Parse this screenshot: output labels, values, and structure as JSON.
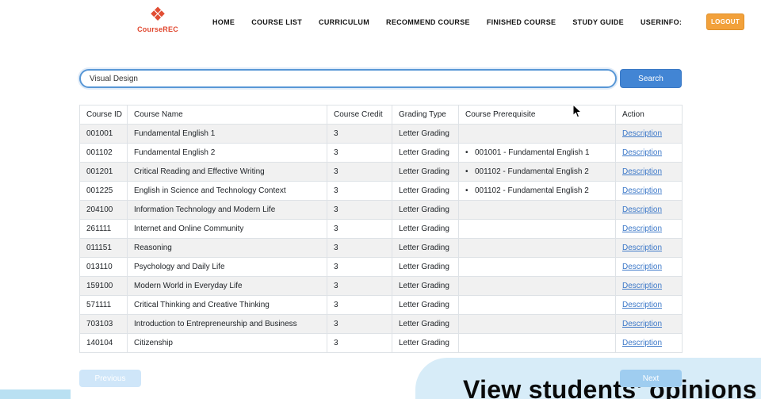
{
  "brand": {
    "name": "CourseREC"
  },
  "nav": {
    "items": [
      {
        "label": "HOME"
      },
      {
        "label": "COURSE LIST"
      },
      {
        "label": "CURRICULUM"
      },
      {
        "label": "RECOMMEND COURSE"
      },
      {
        "label": "FINISHED COURSE"
      },
      {
        "label": "STUDY GUIDE"
      },
      {
        "label": "USERINFO:"
      }
    ],
    "logout_label": "LOGOUT"
  },
  "search": {
    "value": "Visual Design",
    "button_label": "Search"
  },
  "table": {
    "headers": [
      "Course ID",
      "Course Name",
      "Course Credit",
      "Grading Type",
      "Course Prerequisite",
      "Action"
    ],
    "action_label": "Description",
    "rows": [
      {
        "id": "001001",
        "name": "Fundamental English 1",
        "credit": "3",
        "grading": "Letter Grading",
        "prerequisite": ""
      },
      {
        "id": "001102",
        "name": "Fundamental English 2",
        "credit": "3",
        "grading": "Letter Grading",
        "prerequisite": "001001 - Fundamental English 1"
      },
      {
        "id": "001201",
        "name": "Critical Reading and Effective Writing",
        "credit": "3",
        "grading": "Letter Grading",
        "prerequisite": "001102 - Fundamental English 2"
      },
      {
        "id": "001225",
        "name": "English in Science and Technology Context",
        "credit": "3",
        "grading": "Letter Grading",
        "prerequisite": "001102 - Fundamental English 2"
      },
      {
        "id": "204100",
        "name": "Information Technology and Modern Life",
        "credit": "3",
        "grading": "Letter Grading",
        "prerequisite": ""
      },
      {
        "id": "261111",
        "name": "Internet and Online Community",
        "credit": "3",
        "grading": "Letter Grading",
        "prerequisite": ""
      },
      {
        "id": "011151",
        "name": "Reasoning",
        "credit": "3",
        "grading": "Letter Grading",
        "prerequisite": ""
      },
      {
        "id": "013110",
        "name": "Psychology and Daily Life",
        "credit": "3",
        "grading": "Letter Grading",
        "prerequisite": ""
      },
      {
        "id": "159100",
        "name": "Modern World in Everyday Life",
        "credit": "3",
        "grading": "Letter Grading",
        "prerequisite": ""
      },
      {
        "id": "571111",
        "name": "Critical Thinking and Creative Thinking",
        "credit": "3",
        "grading": "Letter Grading",
        "prerequisite": ""
      },
      {
        "id": "703103",
        "name": "Introduction to Entrepreneurship and Business",
        "credit": "3",
        "grading": "Letter Grading",
        "prerequisite": ""
      },
      {
        "id": "140104",
        "name": "Citizenship",
        "credit": "3",
        "grading": "Letter Grading",
        "prerequisite": ""
      }
    ]
  },
  "pagination": {
    "previous_label": "Previous",
    "next_label": "Next"
  },
  "overlay": {
    "caption": "View students’ opinions"
  },
  "icons": {
    "logo_glyph": "❖",
    "bullet": "•"
  },
  "colors": {
    "accent_blue": "#4285d4",
    "logout_orange": "#f2a13b",
    "link_blue": "#3c78c8",
    "stripe_gray": "#f1f1f1",
    "overlay_blue": "#d7ecf8",
    "pagination_blue": "#9fcdf0",
    "brand_red": "#e0472f"
  }
}
